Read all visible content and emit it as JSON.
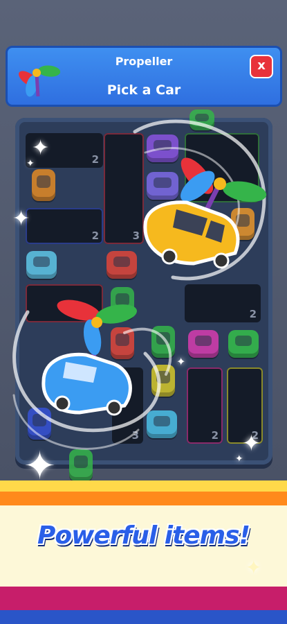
{
  "header": {
    "title": "Propeller",
    "subtitle": "Pick a Car",
    "close_label": "x",
    "icon": "propeller-icon"
  },
  "board": {
    "slot_numbers": [
      "2",
      "3",
      "2",
      "2",
      "3",
      "2",
      "2"
    ]
  },
  "banner": {
    "text": "Powerful items!"
  },
  "colors": {
    "header_blue": "#3f8ff0",
    "close_red": "#e8323a",
    "banner_text": "#2a5fe8",
    "banner_bg": "#fdf8d8",
    "stripe_yellow": "#ffd94a",
    "stripe_orange": "#ff8a1c",
    "stripe_magenta": "#c71e6a",
    "stripe_blue": "#2a55c8",
    "yellow_car": "#f6b91e",
    "blue_car": "#3b9cf2"
  }
}
